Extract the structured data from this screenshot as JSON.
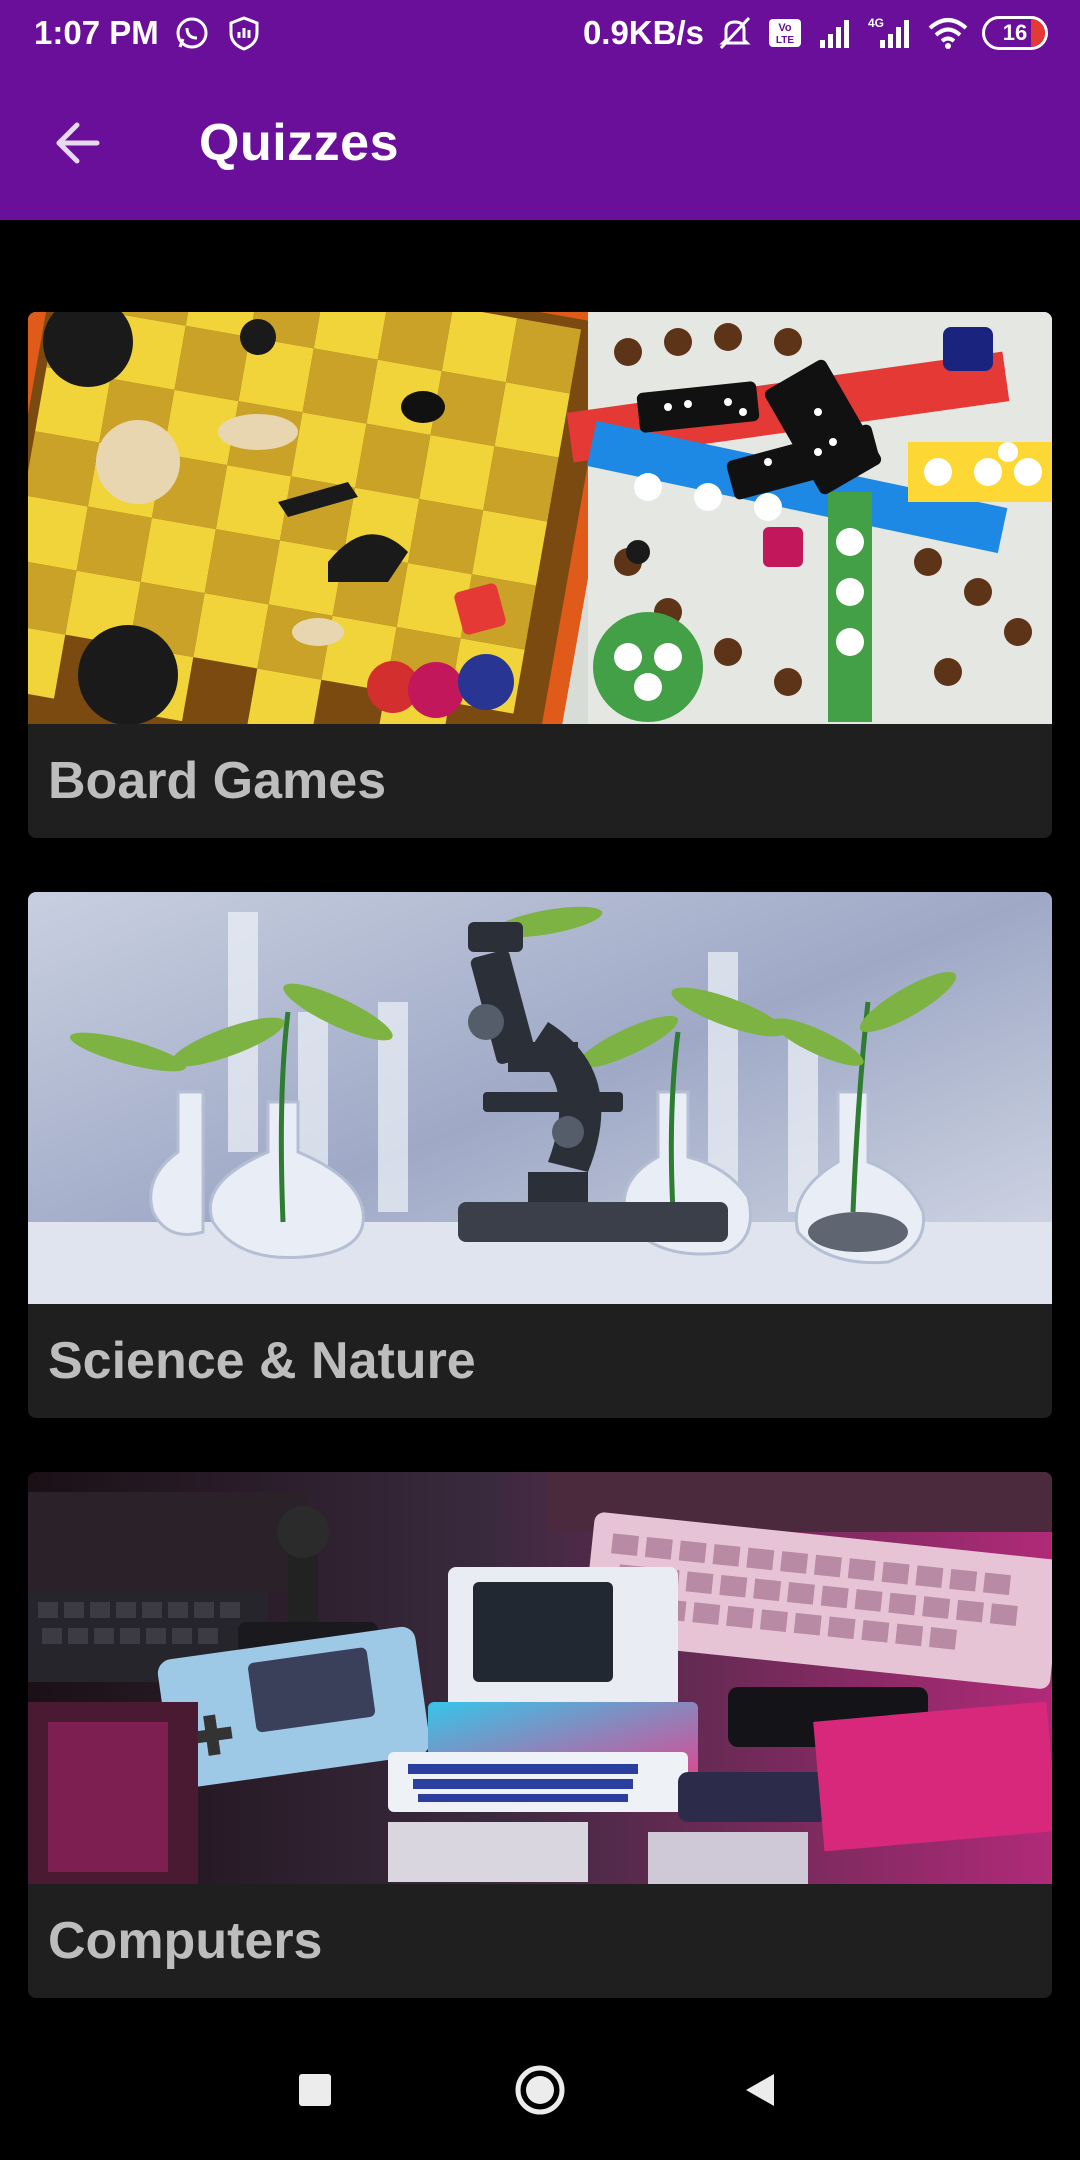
{
  "status_bar": {
    "time": "1:07 PM",
    "speed": "0.9KB/s",
    "network_label": "4G",
    "battery": "16",
    "icons": [
      "whatsapp-icon",
      "shield-icon",
      "mute-icon",
      "volte-icon",
      "signal-icon",
      "signal-4g-icon",
      "wifi-icon",
      "battery-icon"
    ]
  },
  "app_bar": {
    "title": "Quizzes",
    "back_icon": "arrow-left-icon"
  },
  "colors": {
    "app_bar": "#6a0f99",
    "card": "#1f1f1f",
    "card_label": "#bdbdbd",
    "background": "#000000"
  },
  "quizzes": [
    {
      "label": "Board Games",
      "image": "board-games-image"
    },
    {
      "label": "Science & Nature",
      "image": "science-nature-image"
    },
    {
      "label": "Computers",
      "image": "computers-image"
    }
  ],
  "nav_bar": {
    "buttons": [
      "recents-square-icon",
      "home-circle-icon",
      "back-triangle-icon"
    ]
  }
}
